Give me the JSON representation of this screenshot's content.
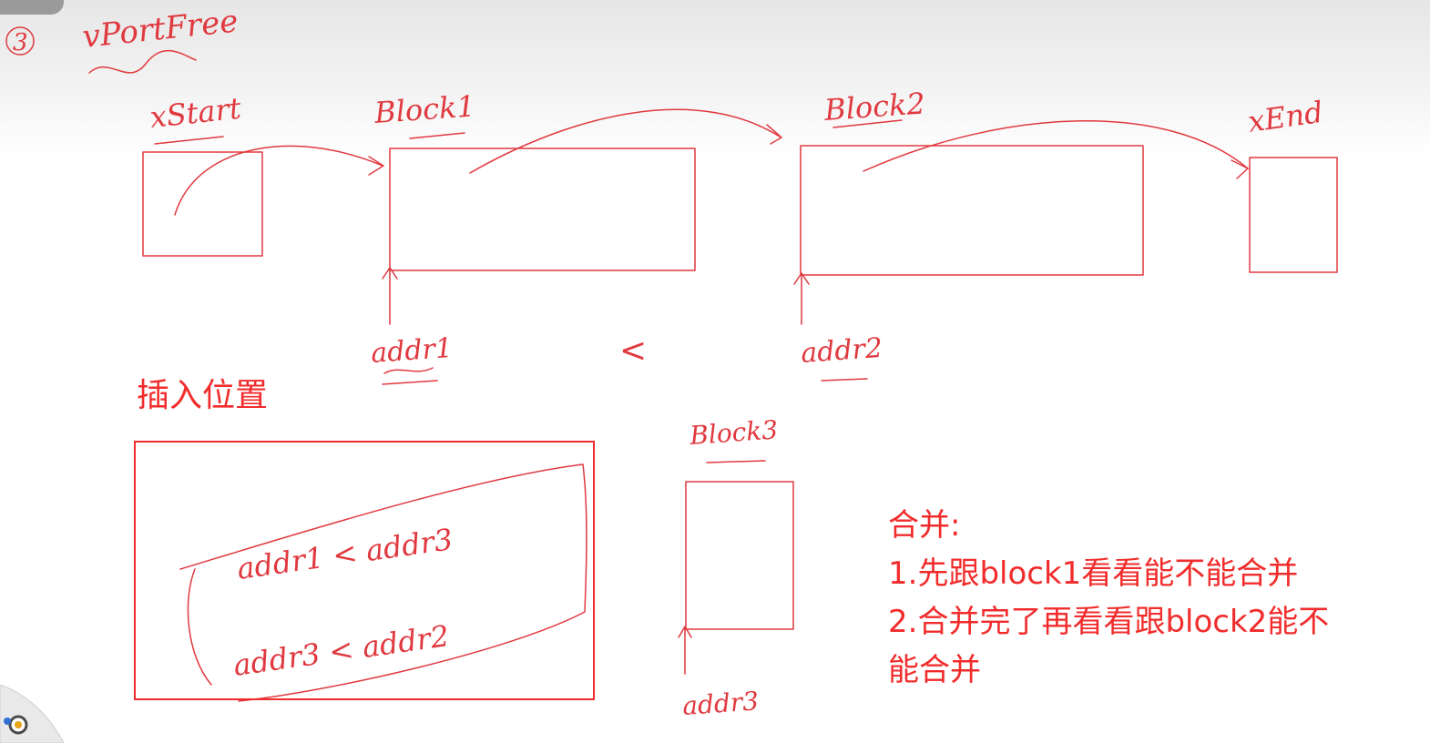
{
  "step_marker": "3",
  "function_name": "vPortFree",
  "labels": {
    "xstart": "xStart",
    "block1": "Block1",
    "block2": "Block2",
    "xend": "xEnd",
    "block3": "Block3",
    "addr1": "addr1",
    "addr2": "addr2",
    "addr3": "addr3",
    "less_than": "<"
  },
  "insert_position": {
    "title": "插入位置",
    "condition_1": "addr1 < addr3",
    "condition_2": "addr3 < addr2"
  },
  "merge_note": {
    "heading": "合并:",
    "line1": "1.先跟block1看看能不能合并",
    "line2": "2.合并完了再看看跟block2能不",
    "line3": "能合并"
  },
  "colors": {
    "ink": "#e0393f",
    "typed_text": "#f22c2c",
    "background": "#ffffff"
  }
}
